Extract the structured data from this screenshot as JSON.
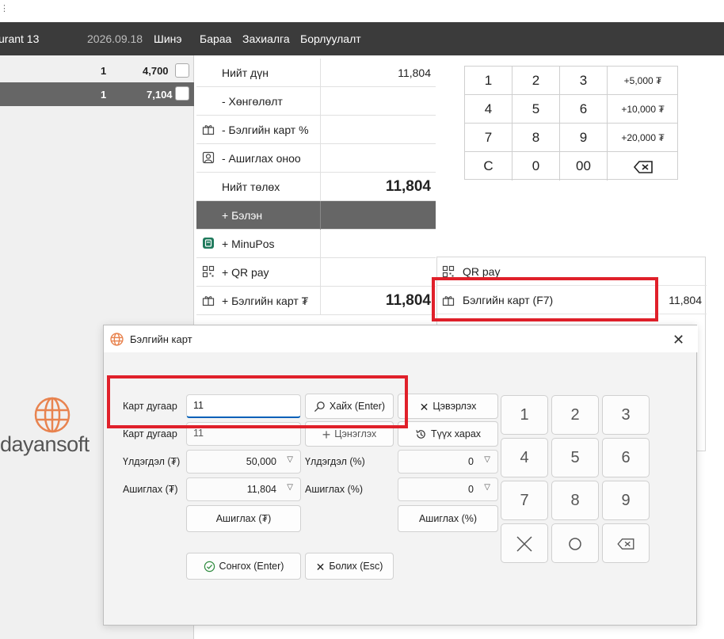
{
  "header": {
    "restaurant": "urant 13",
    "date": "2026.09.18",
    "menu": [
      "Шинэ",
      "Бараа",
      "Захиалга",
      "Борлуулалт"
    ]
  },
  "orders": [
    {
      "qty": "1",
      "amount": "4,700"
    },
    {
      "qty": "1",
      "amount": "7,104"
    }
  ],
  "brand": {
    "name": "dayansoft",
    "color": "#e8834f"
  },
  "payments": [
    {
      "label": "Нийт дүн",
      "value": "11,804",
      "big": false,
      "icon": ""
    },
    {
      "label": "- Хөнгөлөлт",
      "value": "",
      "big": false,
      "icon": ""
    },
    {
      "label": "- Бэлгийн карт %",
      "value": "",
      "big": false,
      "icon": "gift-card-icon"
    },
    {
      "label": "- Ашиглах оноо",
      "value": "",
      "big": false,
      "icon": "user-points-icon"
    },
    {
      "label": "Нийт төлөх",
      "value": "11,804",
      "big": true,
      "icon": ""
    },
    {
      "label": "+ Бэлэн",
      "value": "",
      "big": false,
      "icon": ""
    },
    {
      "label": "+ MinuPos",
      "value": "",
      "big": false,
      "icon": "minupos-icon"
    },
    {
      "label": "+ QR pay",
      "value": "",
      "big": false,
      "icon": "qr-icon"
    },
    {
      "label": "+ Бэлгийн карт ₮",
      "value": "11,804",
      "big": true,
      "icon": "gift-card-icon"
    }
  ],
  "numpad": {
    "keys": [
      "1",
      "2",
      "3",
      "4",
      "5",
      "6",
      "7",
      "8",
      "9",
      "C",
      "0",
      "00"
    ],
    "quick": [
      "+5,000 ₮",
      "+10,000 ₮",
      "+20,000 ₮"
    ]
  },
  "methods": [
    {
      "label": "QR pay",
      "value": "",
      "icon": "qr-icon"
    },
    {
      "label": "Бэлгийн карт (F7)",
      "value": "11,804",
      "icon": "gift-card-icon"
    }
  ],
  "dialog": {
    "title": "Бэлгийн карт",
    "card_label": "Карт дугаар",
    "card_input": "11",
    "card_label2": "Карт дугаар",
    "card_value2": "11",
    "search_btn": "Хайх (Enter)",
    "clear_btn": "Цэвэрлэх",
    "refresh_btn": "Цэнэглэх",
    "history_btn": "Түүх харах",
    "remain_amt_label": "Үлдэгдэл (₮)",
    "remain_amt": "50,000",
    "remain_pct_label": "Үлдэгдэл (%)",
    "remain_pct": "0",
    "use_amt_label": "Ашиглах (₮)",
    "use_amt": "11,804",
    "use_pct_label": "Ашиглах (%)",
    "use_pct": "0",
    "use_amt_btn": "Ашиглах (₮)",
    "use_pct_btn": "Ашиглах (%)",
    "select_btn": "Сонгох (Enter)",
    "cancel_btn": "Болих (Esc)",
    "keys": [
      "1",
      "2",
      "3",
      "4",
      "5",
      "6",
      "7",
      "8",
      "9"
    ]
  },
  "colors": {
    "highlight": "#e0202a",
    "header": "#3b3b3b",
    "accent": "#005fb8"
  }
}
